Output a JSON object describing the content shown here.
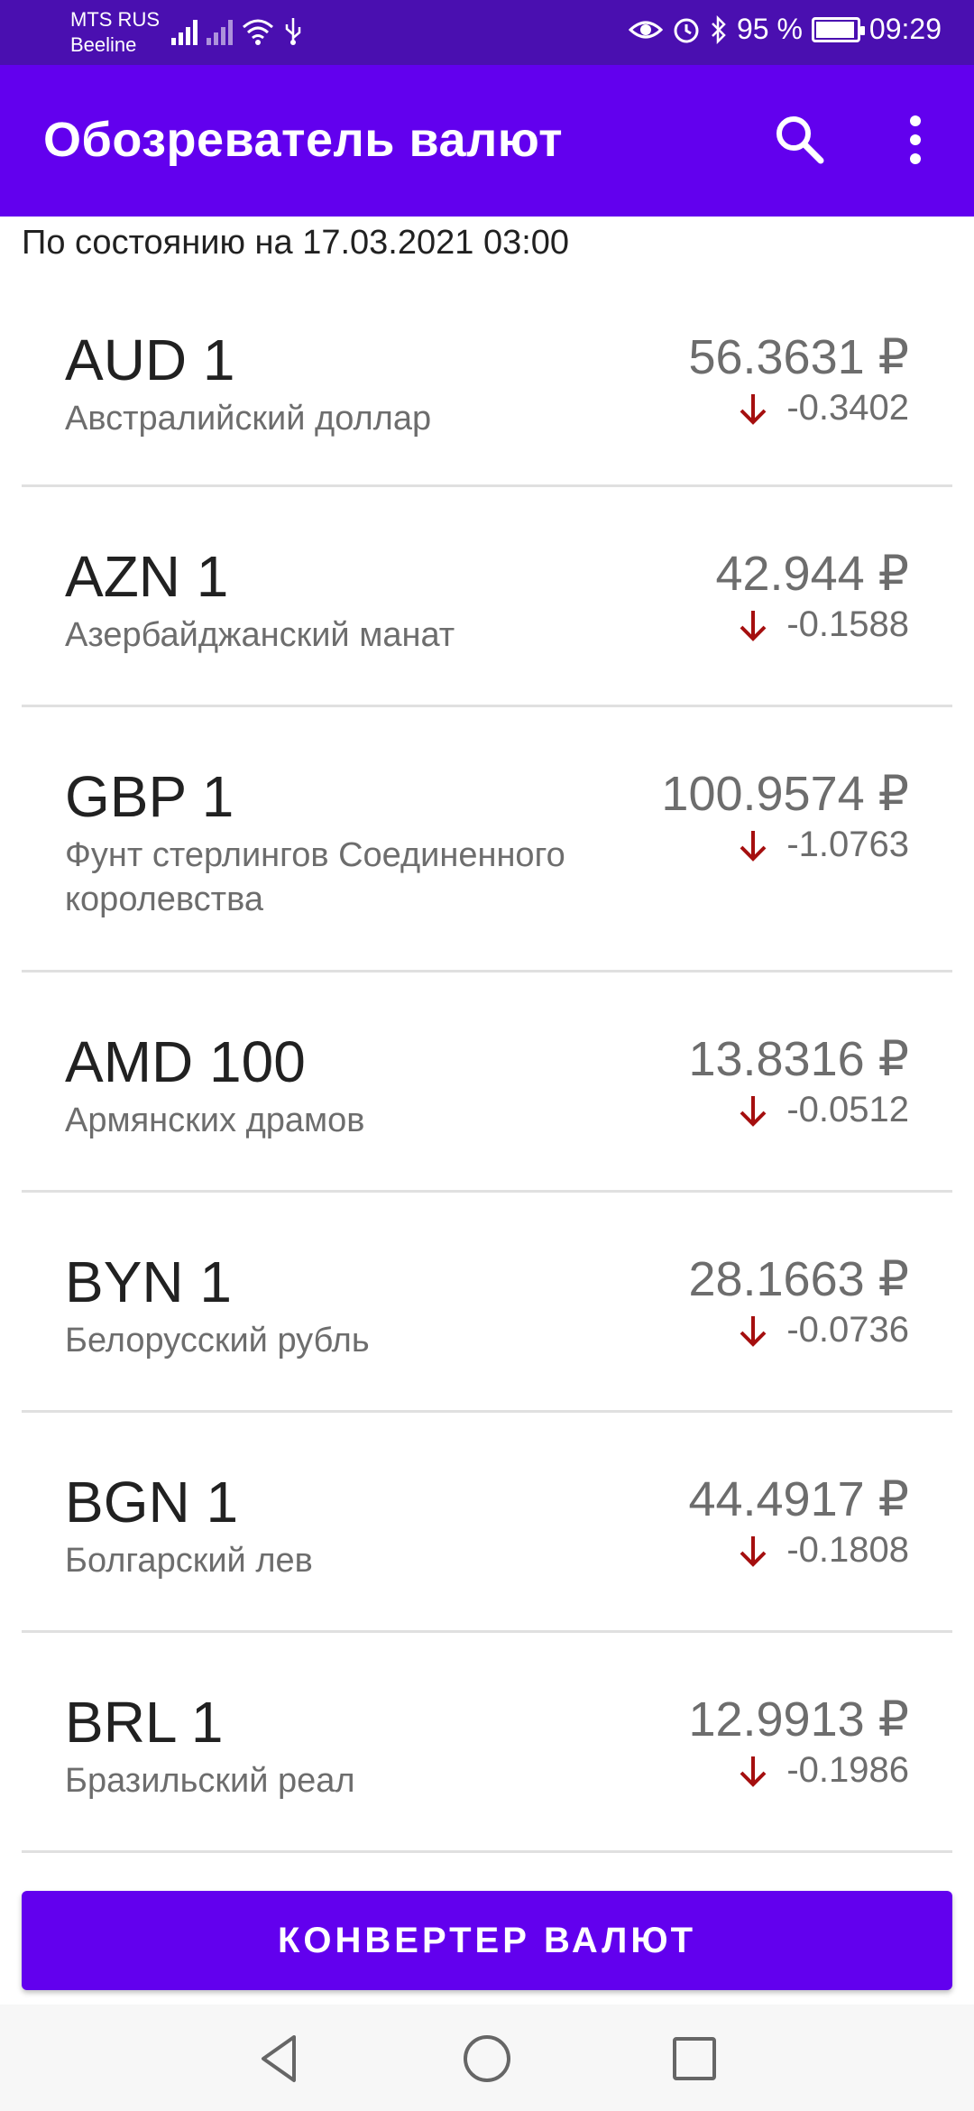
{
  "status_bar": {
    "carrier1": "MTS RUS",
    "carrier2": "Beeline",
    "battery": "95 %",
    "time": "09:29",
    "battery_level": 0.95
  },
  "app_bar": {
    "title": "Обозреватель валют",
    "search_icon": "search-icon",
    "menu_icon": "more-vert-icon"
  },
  "date_line": "По состоянию на 17.03.2021 03:00",
  "currencies": [
    {
      "code": "AUD 1",
      "name": "Австралийский доллар",
      "rate": "56.3631 ₽",
      "delta": "-0.3402"
    },
    {
      "code": "AZN 1",
      "name": "Азербайджанский манат",
      "rate": "42.944 ₽",
      "delta": "-0.1588"
    },
    {
      "code": "GBP 1",
      "name": "Фунт стерлингов Соединенного королевства",
      "rate": "100.9574 ₽",
      "delta": "-1.0763"
    },
    {
      "code": "AMD 100",
      "name": "Армянских драмов",
      "rate": "13.8316 ₽",
      "delta": "-0.0512"
    },
    {
      "code": "BYN 1",
      "name": "Белорусский рубль",
      "rate": "28.1663 ₽",
      "delta": "-0.0736"
    },
    {
      "code": "BGN 1",
      "name": "Болгарский лев",
      "rate": "44.4917 ₽",
      "delta": "-0.1808"
    },
    {
      "code": "BRL 1",
      "name": "Бразильский реал",
      "rate": "12.9913 ₽",
      "delta": "-0.1986"
    }
  ],
  "convert_button": "КОНВЕРТЕР ВАЛЮТ",
  "colors": {
    "primary": "#6200ee",
    "status_bar": "#4a0fb0",
    "down_arrow": "#a50f0f"
  }
}
